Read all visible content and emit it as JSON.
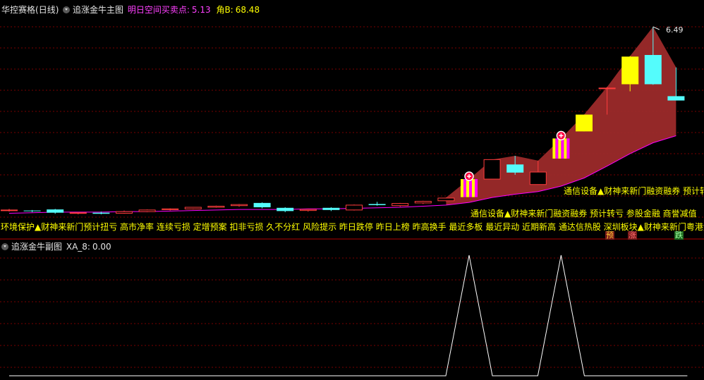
{
  "main_panel": {
    "stock_name": "华控赛格",
    "period": "(日线)",
    "indicator_name": "追涨金牛主图",
    "field1_label": "明日空间买卖点:",
    "field1_value": "5.13",
    "field2_label": "角B:",
    "field2_value": "68.48",
    "high_label": "6.49"
  },
  "sub_panel": {
    "indicator_name": "追涨金牛副图",
    "field_label": "XA_8:",
    "field_value": "0.00"
  },
  "concepts_upper": "通信设备▲财神来新门融资融券 预计转",
  "concepts_mid": "通信设备▲财神来新门融资融券 预计转亏 参股金融 商誉减值 ",
  "concepts_bottom": "环境保护▲财神来新门预计扭亏 高市净率 连续亏损 定增预案 扣非亏损 久不分红 风险提示 昨日跌停 昨日上榜 昨高换手 最近多板 最近异动 近期新高 通达信热股 深圳板块▲财神来新门粤港澳",
  "tags": [
    "预",
    "涨",
    "跌"
  ],
  "colors": {
    "up_candle": "#ff3c3c",
    "down_candle": "#54fcfc",
    "yellow_candle": "#ffff00",
    "ma_line": "#ff00ff",
    "cloud": "#9c2a2a",
    "grid": "#7a0000",
    "signal_yellow": "#ffff00",
    "signal_magenta": "#ff00ff",
    "text_yellow": "#ffff00",
    "title_magenta": "#ff40ff"
  },
  "chart_data": {
    "type": "candlestick",
    "title": "追涨金牛主图",
    "high_label": "6.49",
    "candles": [
      {
        "o": 3.1,
        "h": 3.13,
        "l": 3.08,
        "c": 3.11
      },
      {
        "o": 3.1,
        "h": 3.11,
        "l": 3.07,
        "c": 3.09
      },
      {
        "o": 3.12,
        "h": 3.13,
        "l": 3.04,
        "c": 3.06
      },
      {
        "o": 3.05,
        "h": 3.07,
        "l": 3.03,
        "c": 3.06
      },
      {
        "o": 3.06,
        "h": 3.08,
        "l": 3.03,
        "c": 3.04
      },
      {
        "o": 3.05,
        "h": 3.1,
        "l": 3.04,
        "c": 3.08
      },
      {
        "o": 3.08,
        "h": 3.12,
        "l": 3.07,
        "c": 3.11
      },
      {
        "o": 3.12,
        "h": 3.14,
        "l": 3.1,
        "c": 3.13
      },
      {
        "o": 3.13,
        "h": 3.16,
        "l": 3.12,
        "c": 3.16
      },
      {
        "o": 3.16,
        "h": 3.19,
        "l": 3.15,
        "c": 3.18
      },
      {
        "o": 3.19,
        "h": 3.22,
        "l": 3.17,
        "c": 3.21
      },
      {
        "o": 3.24,
        "h": 3.25,
        "l": 3.14,
        "c": 3.16
      },
      {
        "o": 3.15,
        "h": 3.16,
        "l": 3.07,
        "c": 3.09
      },
      {
        "o": 3.1,
        "h": 3.13,
        "l": 3.08,
        "c": 3.12
      },
      {
        "o": 3.15,
        "h": 3.16,
        "l": 3.09,
        "c": 3.11
      },
      {
        "o": 3.11,
        "h": 3.21,
        "l": 3.1,
        "c": 3.2
      },
      {
        "o": 3.22,
        "h": 3.26,
        "l": 3.19,
        "c": 3.2
      },
      {
        "o": 3.19,
        "h": 3.24,
        "l": 3.17,
        "c": 3.23
      },
      {
        "o": 3.24,
        "h": 3.28,
        "l": 3.22,
        "c": 3.27
      },
      {
        "o": 3.28,
        "h": 3.34,
        "l": 3.27,
        "c": 3.33
      },
      {
        "o": 3.4,
        "h": 3.68,
        "l": 3.4,
        "c": 3.67
      },
      {
        "o": 3.68,
        "h": 4.04,
        "l": 3.68,
        "c": 4.04
      },
      {
        "o": 3.95,
        "h": 4.11,
        "l": 3.76,
        "c": 3.8
      },
      {
        "o": 3.58,
        "h": 4.02,
        "l": 3.58,
        "c": 3.81
      },
      {
        "o": 4.11,
        "h": 4.43,
        "l": 4.11,
        "c": 4.43
      },
      {
        "o": 4.56,
        "h": 4.87,
        "l": 4.56,
        "c": 4.87
      },
      {
        "o": 5.36,
        "h": 5.38,
        "l": 4.87,
        "c": 5.36
      },
      {
        "o": 5.94,
        "h": 5.95,
        "l": 5.3,
        "c": 5.43
      },
      {
        "o": 5.97,
        "h": 6.49,
        "l": 5.42,
        "c": 5.43
      },
      {
        "o": 5.21,
        "h": 5.74,
        "l": 5.17,
        "c": 5.13
      }
    ],
    "ma": [
      3.05,
      3.06,
      3.07,
      3.07,
      3.07,
      3.08,
      3.08,
      3.09,
      3.1,
      3.11,
      3.12,
      3.12,
      3.12,
      3.13,
      3.13,
      3.14,
      3.15,
      3.16,
      3.18,
      3.2,
      3.25,
      3.34,
      3.4,
      3.45,
      3.55,
      3.7,
      3.92,
      4.15,
      4.35,
      4.48
    ],
    "yellow_candles": [
      25,
      27
    ],
    "signal_bars": [
      20,
      24
    ],
    "xa8": [
      0,
      0,
      0,
      0,
      0,
      0,
      0,
      0,
      0,
      0,
      0,
      0,
      0,
      0,
      0,
      0,
      0,
      0,
      0,
      0,
      1,
      0,
      0,
      0,
      1,
      0,
      0,
      0,
      0,
      0
    ]
  }
}
